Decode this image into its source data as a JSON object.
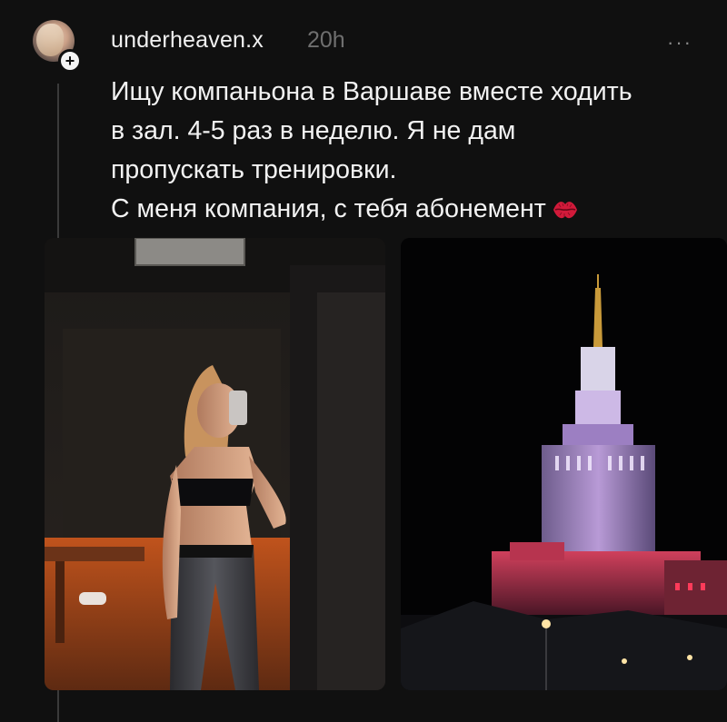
{
  "post": {
    "username": "underheaven.x",
    "timestamp": "20h",
    "more_label": "···",
    "follow_label": "+",
    "text_lines": [
      "Ищу компаньона в Варшаве вместе ходить",
      "в зал. 4-5 раз в неделю. Я не дам",
      "пропускать тренировки.",
      "С меня компания, с тебя абонемент"
    ],
    "emoji": "kiss-mark-icon",
    "accent_color": "#d11a3a"
  },
  "media": [
    {
      "name": "gym-mirror-selfie-photo"
    },
    {
      "name": "palace-of-culture-night-photo"
    }
  ]
}
